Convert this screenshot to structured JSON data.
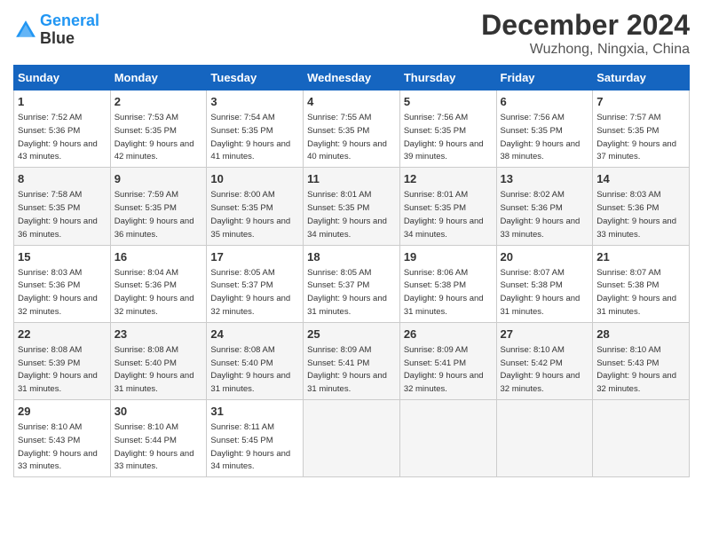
{
  "header": {
    "logo_line1": "General",
    "logo_line2": "Blue",
    "title": "December 2024",
    "subtitle": "Wuzhong, Ningxia, China"
  },
  "weekdays": [
    "Sunday",
    "Monday",
    "Tuesday",
    "Wednesday",
    "Thursday",
    "Friday",
    "Saturday"
  ],
  "weeks": [
    [
      {
        "day": "1",
        "sunrise": "Sunrise: 7:52 AM",
        "sunset": "Sunset: 5:36 PM",
        "daylight": "Daylight: 9 hours and 43 minutes."
      },
      {
        "day": "2",
        "sunrise": "Sunrise: 7:53 AM",
        "sunset": "Sunset: 5:35 PM",
        "daylight": "Daylight: 9 hours and 42 minutes."
      },
      {
        "day": "3",
        "sunrise": "Sunrise: 7:54 AM",
        "sunset": "Sunset: 5:35 PM",
        "daylight": "Daylight: 9 hours and 41 minutes."
      },
      {
        "day": "4",
        "sunrise": "Sunrise: 7:55 AM",
        "sunset": "Sunset: 5:35 PM",
        "daylight": "Daylight: 9 hours and 40 minutes."
      },
      {
        "day": "5",
        "sunrise": "Sunrise: 7:56 AM",
        "sunset": "Sunset: 5:35 PM",
        "daylight": "Daylight: 9 hours and 39 minutes."
      },
      {
        "day": "6",
        "sunrise": "Sunrise: 7:56 AM",
        "sunset": "Sunset: 5:35 PM",
        "daylight": "Daylight: 9 hours and 38 minutes."
      },
      {
        "day": "7",
        "sunrise": "Sunrise: 7:57 AM",
        "sunset": "Sunset: 5:35 PM",
        "daylight": "Daylight: 9 hours and 37 minutes."
      }
    ],
    [
      {
        "day": "8",
        "sunrise": "Sunrise: 7:58 AM",
        "sunset": "Sunset: 5:35 PM",
        "daylight": "Daylight: 9 hours and 36 minutes."
      },
      {
        "day": "9",
        "sunrise": "Sunrise: 7:59 AM",
        "sunset": "Sunset: 5:35 PM",
        "daylight": "Daylight: 9 hours and 36 minutes."
      },
      {
        "day": "10",
        "sunrise": "Sunrise: 8:00 AM",
        "sunset": "Sunset: 5:35 PM",
        "daylight": "Daylight: 9 hours and 35 minutes."
      },
      {
        "day": "11",
        "sunrise": "Sunrise: 8:01 AM",
        "sunset": "Sunset: 5:35 PM",
        "daylight": "Daylight: 9 hours and 34 minutes."
      },
      {
        "day": "12",
        "sunrise": "Sunrise: 8:01 AM",
        "sunset": "Sunset: 5:35 PM",
        "daylight": "Daylight: 9 hours and 34 minutes."
      },
      {
        "day": "13",
        "sunrise": "Sunrise: 8:02 AM",
        "sunset": "Sunset: 5:36 PM",
        "daylight": "Daylight: 9 hours and 33 minutes."
      },
      {
        "day": "14",
        "sunrise": "Sunrise: 8:03 AM",
        "sunset": "Sunset: 5:36 PM",
        "daylight": "Daylight: 9 hours and 33 minutes."
      }
    ],
    [
      {
        "day": "15",
        "sunrise": "Sunrise: 8:03 AM",
        "sunset": "Sunset: 5:36 PM",
        "daylight": "Daylight: 9 hours and 32 minutes."
      },
      {
        "day": "16",
        "sunrise": "Sunrise: 8:04 AM",
        "sunset": "Sunset: 5:36 PM",
        "daylight": "Daylight: 9 hours and 32 minutes."
      },
      {
        "day": "17",
        "sunrise": "Sunrise: 8:05 AM",
        "sunset": "Sunset: 5:37 PM",
        "daylight": "Daylight: 9 hours and 32 minutes."
      },
      {
        "day": "18",
        "sunrise": "Sunrise: 8:05 AM",
        "sunset": "Sunset: 5:37 PM",
        "daylight": "Daylight: 9 hours and 31 minutes."
      },
      {
        "day": "19",
        "sunrise": "Sunrise: 8:06 AM",
        "sunset": "Sunset: 5:38 PM",
        "daylight": "Daylight: 9 hours and 31 minutes."
      },
      {
        "day": "20",
        "sunrise": "Sunrise: 8:07 AM",
        "sunset": "Sunset: 5:38 PM",
        "daylight": "Daylight: 9 hours and 31 minutes."
      },
      {
        "day": "21",
        "sunrise": "Sunrise: 8:07 AM",
        "sunset": "Sunset: 5:38 PM",
        "daylight": "Daylight: 9 hours and 31 minutes."
      }
    ],
    [
      {
        "day": "22",
        "sunrise": "Sunrise: 8:08 AM",
        "sunset": "Sunset: 5:39 PM",
        "daylight": "Daylight: 9 hours and 31 minutes."
      },
      {
        "day": "23",
        "sunrise": "Sunrise: 8:08 AM",
        "sunset": "Sunset: 5:40 PM",
        "daylight": "Daylight: 9 hours and 31 minutes."
      },
      {
        "day": "24",
        "sunrise": "Sunrise: 8:08 AM",
        "sunset": "Sunset: 5:40 PM",
        "daylight": "Daylight: 9 hours and 31 minutes."
      },
      {
        "day": "25",
        "sunrise": "Sunrise: 8:09 AM",
        "sunset": "Sunset: 5:41 PM",
        "daylight": "Daylight: 9 hours and 31 minutes."
      },
      {
        "day": "26",
        "sunrise": "Sunrise: 8:09 AM",
        "sunset": "Sunset: 5:41 PM",
        "daylight": "Daylight: 9 hours and 32 minutes."
      },
      {
        "day": "27",
        "sunrise": "Sunrise: 8:10 AM",
        "sunset": "Sunset: 5:42 PM",
        "daylight": "Daylight: 9 hours and 32 minutes."
      },
      {
        "day": "28",
        "sunrise": "Sunrise: 8:10 AM",
        "sunset": "Sunset: 5:43 PM",
        "daylight": "Daylight: 9 hours and 32 minutes."
      }
    ],
    [
      {
        "day": "29",
        "sunrise": "Sunrise: 8:10 AM",
        "sunset": "Sunset: 5:43 PM",
        "daylight": "Daylight: 9 hours and 33 minutes."
      },
      {
        "day": "30",
        "sunrise": "Sunrise: 8:10 AM",
        "sunset": "Sunset: 5:44 PM",
        "daylight": "Daylight: 9 hours and 33 minutes."
      },
      {
        "day": "31",
        "sunrise": "Sunrise: 8:11 AM",
        "sunset": "Sunset: 5:45 PM",
        "daylight": "Daylight: 9 hours and 34 minutes."
      },
      null,
      null,
      null,
      null
    ]
  ]
}
